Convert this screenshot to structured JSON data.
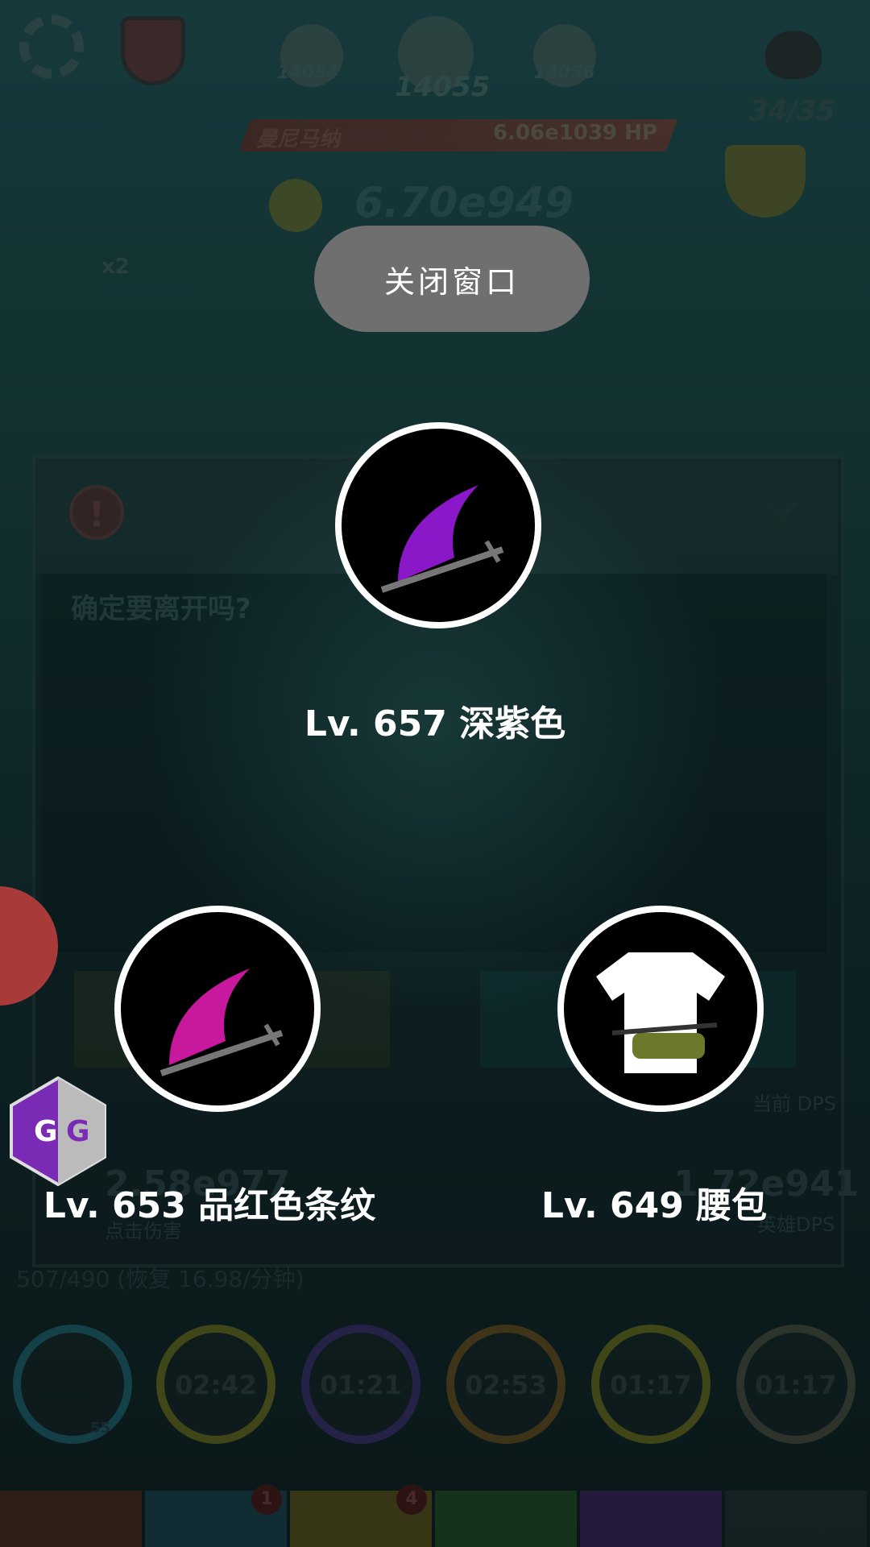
{
  "hud": {
    "stage_prev": "14054",
    "stage_current": "14055",
    "stage_next": "14056",
    "boss_name": "曼尼马纳",
    "boss_hp": "6.06e1039 HP",
    "gold": "6.70e949",
    "relic_progress": "34/35",
    "multiplier": "x2"
  },
  "dialog": {
    "question": "确定要离开吗?",
    "stat_left": "2.58e977",
    "stat_left_label": "点击伤害",
    "stat_right": "1.72e941",
    "stat_right_label": "英雄DPS",
    "stat_current_label": "当前 DPS"
  },
  "energy": "507/490  (恢复 16.98/分钟)",
  "skills": [
    {
      "time": "",
      "level": "55",
      "color": "#1d5f6d"
    },
    {
      "time": "02:42",
      "color": "#6b6a16"
    },
    {
      "time": "01:21",
      "color": "#3a2a6b"
    },
    {
      "time": "02:53",
      "color": "#6b4a16"
    },
    {
      "time": "01:17",
      "color": "#6b6a16"
    },
    {
      "time": "01:17",
      "color": "#4a4a3a"
    }
  ],
  "tabs": [
    {
      "color": "#4a2418",
      "badge": ""
    },
    {
      "color": "#173e4a",
      "badge": "1"
    },
    {
      "color": "#5a5014",
      "badge": "4"
    },
    {
      "color": "#1e4a1e",
      "badge": ""
    },
    {
      "color": "#3a1e5a",
      "badge": ""
    },
    {
      "color": "#1e2a2a",
      "badge": ""
    }
  ],
  "popup": {
    "close_label": "关闭窗口",
    "items": [
      {
        "label": "Lv. 657 深紫色",
        "icon": "purple-scythe-icon",
        "color": "#8a18c8"
      },
      {
        "label": "Lv. 653 品红色条纹",
        "icon": "magenta-scythe-icon",
        "color": "#c8189e"
      },
      {
        "label": "Lv. 649 腰包",
        "icon": "tshirt-waist-bag-icon",
        "color": "#ffffff"
      }
    ]
  },
  "overlay": {
    "gg_text": "GG"
  }
}
